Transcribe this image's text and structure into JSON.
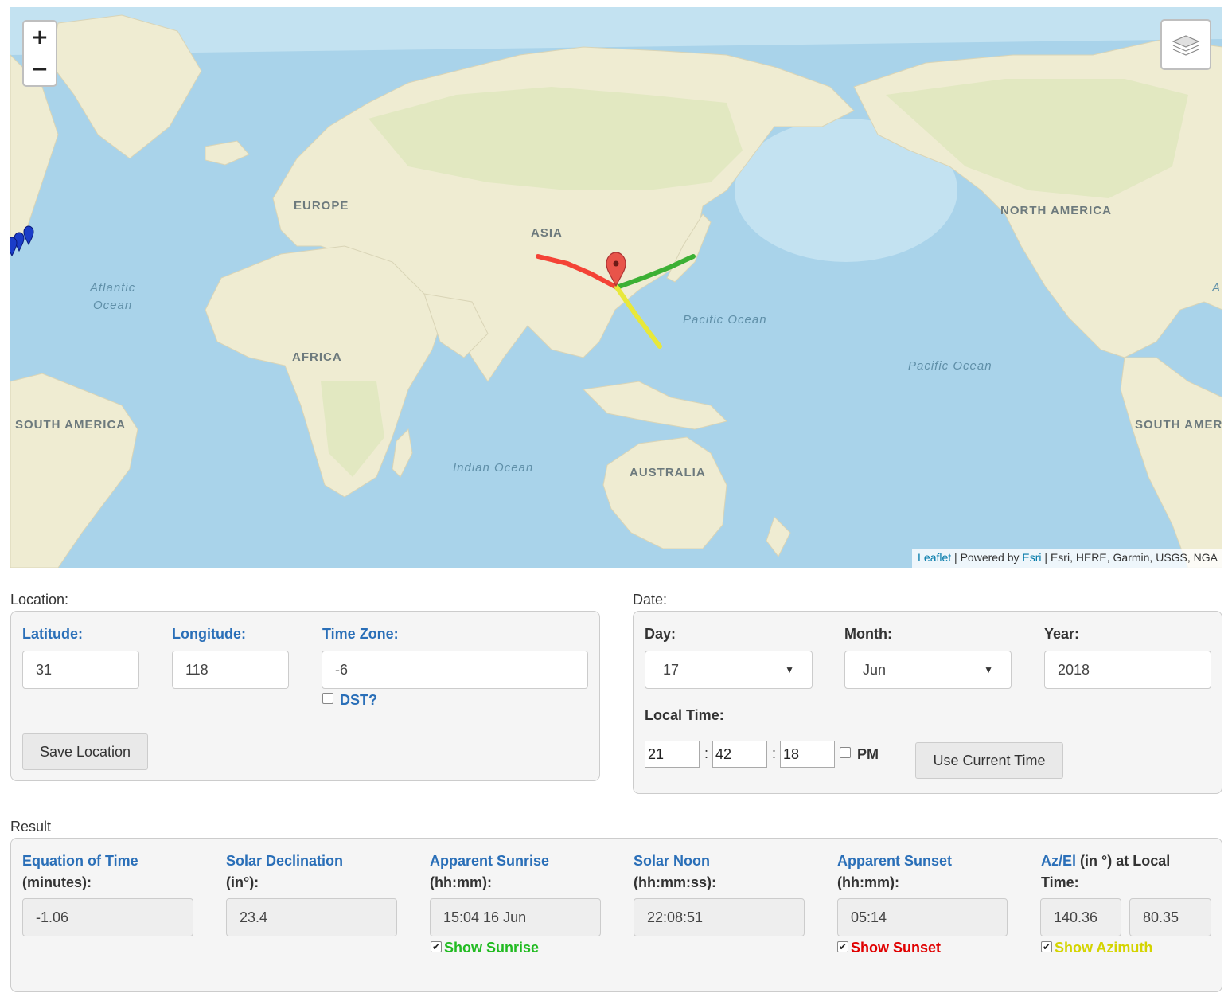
{
  "map": {
    "zoom_in": "+",
    "zoom_out": "−",
    "layers_icon": "layers-icon",
    "continents": {
      "europe": "EUROPE",
      "asia": "ASIA",
      "africa": "AFRICA",
      "north_america": "NORTH AMERICA",
      "south_america_left": "SOUTH AMERICA",
      "south_america_right": "SOUTH AMER",
      "australia": "AUSTRALIA"
    },
    "oceans": {
      "atlantic": "Atlantic\nOcean",
      "atlantic_edge": "A",
      "pacific_1": "Pacific Ocean",
      "pacific_2": "Pacific Ocean",
      "indian": "Indian Ocean"
    },
    "attribution": {
      "leaflet": "Leaflet",
      "sep1": " | Powered by ",
      "esri": "Esri",
      "rest": " | Esri, HERE, Garmin, USGS, NGA"
    },
    "line_colors": {
      "sunset": "#f44336",
      "sunrise": "#3cb034",
      "azimuth": "#e8e83a",
      "marker": "#e8544a"
    }
  },
  "location": {
    "section_title": "Location:",
    "latitude_label": "Latitude:",
    "latitude_value": "31",
    "longitude_label": "Longitude:",
    "longitude_value": "118",
    "timezone_label": "Time Zone:",
    "timezone_value": "-6",
    "dst_label": "DST?",
    "save_button": "Save Location"
  },
  "date": {
    "section_title": "Date:",
    "day_label": "Day:",
    "day_value": "17",
    "month_label": "Month:",
    "month_value": "Jun",
    "year_label": "Year:",
    "year_value": "2018",
    "local_time_label": "Local Time:",
    "hour": "21",
    "minute": "42",
    "second": "18",
    "colon": ":",
    "pm_label": "PM",
    "use_current_button": "Use Current Time"
  },
  "result": {
    "section_title": "Result",
    "eot_label_1": "Equation of Time",
    "eot_label_2": "(minutes):",
    "eot_value": "-1.06",
    "decl_label_1": "Solar Declination",
    "decl_label_2": "(in°):",
    "decl_value": "23.4",
    "sunrise_label_1": "Apparent Sunrise",
    "sunrise_label_2": "(hh:mm):",
    "sunrise_value": "15:04 16 Jun",
    "show_sunrise": "Show Sunrise",
    "noon_label_1": "Solar Noon",
    "noon_label_2": "(hh:mm:ss):",
    "noon_value": "22:08:51",
    "sunset_label_1": "Apparent Sunset",
    "sunset_label_2": "(hh:mm):",
    "sunset_value": "05:14",
    "show_sunset": "Show Sunset",
    "azel_label_blue": "Az/El",
    "azel_label_rest": " (in °) at Local",
    "azel_label_2": "Time:",
    "az_value": "140.36",
    "el_value": "80.35",
    "show_azimuth": "Show Azimuth",
    "colors": {
      "sunrise": "#22bb22",
      "sunset": "#e00000",
      "azimuth": "#d4d400"
    }
  }
}
